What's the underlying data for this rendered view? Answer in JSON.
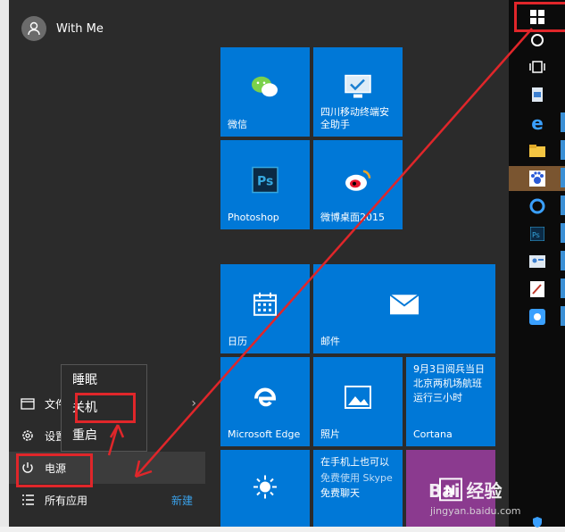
{
  "user": {
    "name": "With Me"
  },
  "left_menu": {
    "file_explorer": "文件资",
    "settings": "设置",
    "power": "电源",
    "all_apps": "所有应用",
    "new": "新建"
  },
  "power_menu": {
    "sleep": "睡眠",
    "shutdown": "关机",
    "restart": "重启"
  },
  "tiles": {
    "wechat": "微信",
    "sichuan_mobile": "四川移动终端安全助手",
    "photoshop": "Photoshop",
    "weibo": "微博桌面2015",
    "calendar": "日历",
    "mail": "邮件",
    "edge": "Microsoft Edge",
    "photos": "照片",
    "cortana_text": "9月3日阅兵当日北京两机场航班运行三小时",
    "cortana": "Cortana",
    "skype_text": "在手机上也可以",
    "skype_sub": "免费聊天"
  },
  "watermark": {
    "main": "Bai 经验",
    "sub": "jingyan.baidu.com"
  },
  "icons": [
    "user-icon",
    "folder-icon",
    "gear-icon",
    "power-icon",
    "list-icon",
    "chevron-right-icon",
    "windows-icon",
    "cortana-circle-icon",
    "task-view-icon"
  ],
  "colors": {
    "tile_blue": "#0078d7",
    "menu_bg": "#2b2b2b",
    "highlight_red": "#e0262a",
    "taskbar": "#0b0b0b"
  }
}
